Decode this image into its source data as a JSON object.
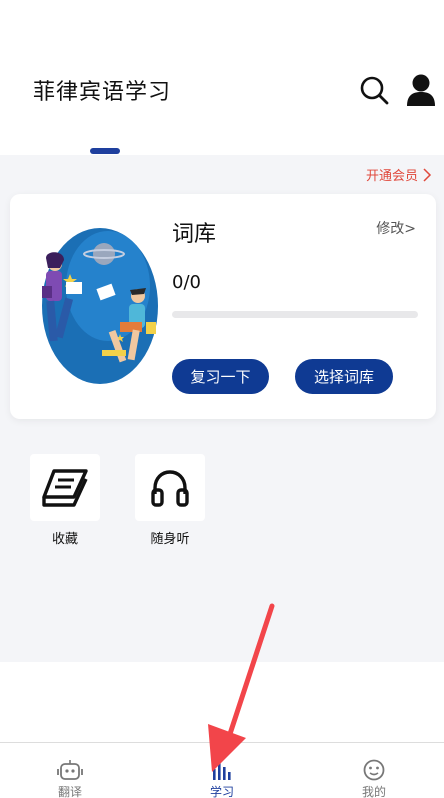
{
  "header": {
    "title": "菲律宾语学习",
    "search_icon": "search-icon",
    "profile_icon": "user-icon"
  },
  "main": {
    "member_link": "开通会员",
    "card": {
      "title": "词库",
      "edit": "修改>",
      "progress_text": "0/0",
      "progress_fraction": 0,
      "buttons": {
        "review": "复习一下",
        "select": "选择词库"
      }
    },
    "tools": [
      {
        "label": "收藏",
        "icon": "book-icon"
      },
      {
        "label": "随身听",
        "icon": "headphones-icon"
      }
    ]
  },
  "bottom_nav": {
    "items": [
      {
        "label": "翻译",
        "icon": "robot-icon",
        "active": false
      },
      {
        "label": "学习",
        "icon": "bar-chart-icon",
        "active": true
      },
      {
        "label": "我的",
        "icon": "face-icon",
        "active": false
      }
    ]
  },
  "colors": {
    "accent": "#1e3f9e",
    "button": "#0f3a93",
    "member": "#e0493c",
    "annotation": "#f2454a"
  }
}
